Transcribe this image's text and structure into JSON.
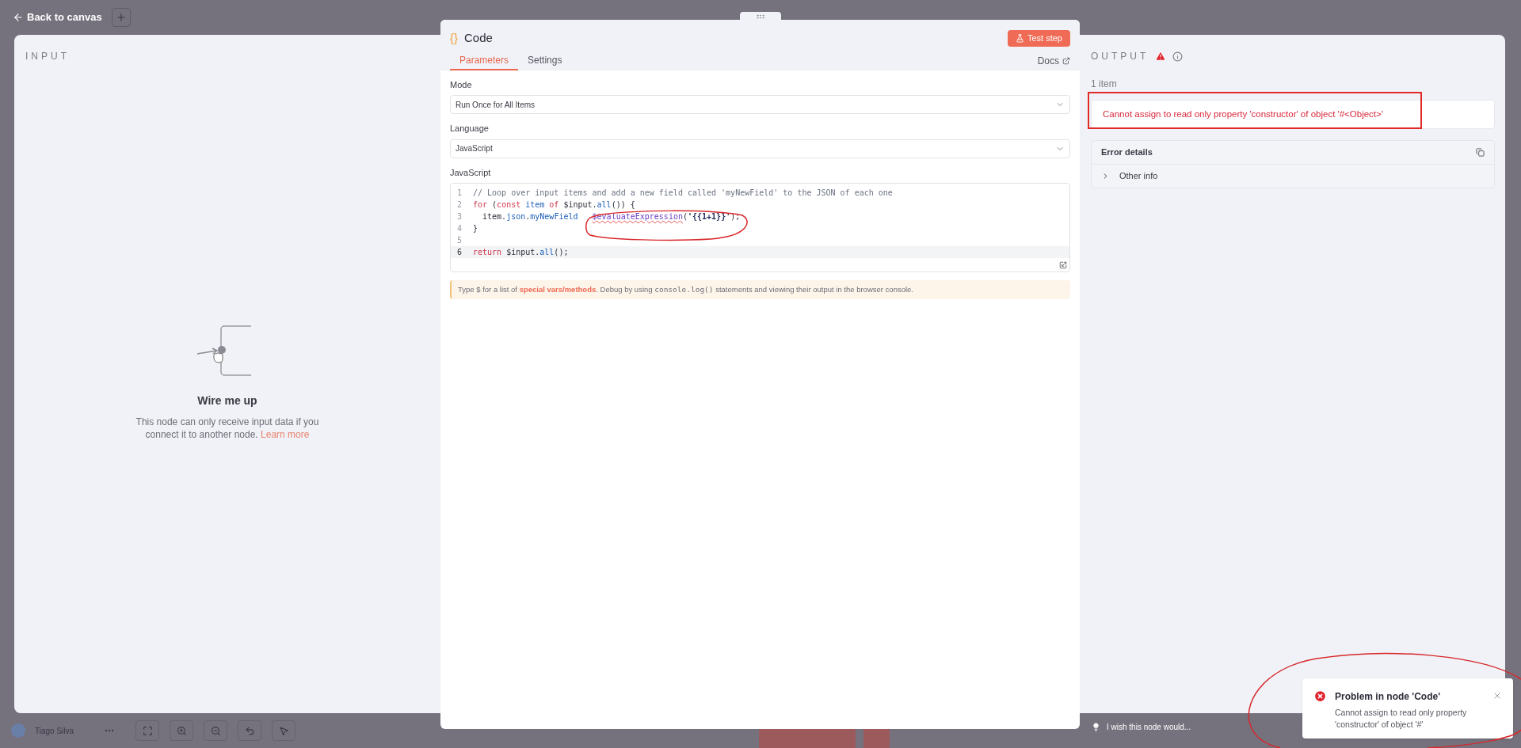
{
  "top_bar": {
    "back_link": "Back to canvas"
  },
  "input": {
    "heading": "INPUT",
    "empty_title": "Wire me up",
    "empty_text": "This node can only receive input data if you connect it to another node.",
    "learn_more": "Learn more"
  },
  "node_panel": {
    "icon_glyph": "{}",
    "title": "Code",
    "test_button": "Test step",
    "tabs": [
      {
        "label": "Parameters",
        "selected": true
      },
      {
        "label": "Settings",
        "selected": false
      }
    ],
    "docs_link": "Docs",
    "fields": [
      {
        "label": "Mode",
        "value": "Run Once for All Items"
      },
      {
        "label": "Language",
        "value": "JavaScript"
      }
    ],
    "editor": {
      "label": "JavaScript",
      "lines": [
        {
          "number": "1",
          "active": false,
          "tokens": [
            {
              "kind": "comment",
              "text": "// Loop over input items and add a new field called 'myNewField' to the JSON of each one"
            }
          ]
        },
        {
          "number": "2",
          "active": false,
          "tokens": [
            {
              "kind": "keyword",
              "text": "for"
            },
            {
              "kind": "plain",
              "text": " ("
            },
            {
              "kind": "keyword",
              "text": "const"
            },
            {
              "kind": "property",
              "text": " item"
            },
            {
              "kind": "keyword",
              "text": " of"
            },
            {
              "kind": "plain",
              "text": " $input."
            },
            {
              "kind": "property",
              "text": "all"
            },
            {
              "kind": "plain",
              "text": "()) {"
            }
          ]
        },
        {
          "number": "3",
          "active": false,
          "tokens": [
            {
              "kind": "plain",
              "text": "  item."
            },
            {
              "kind": "property",
              "text": "json"
            },
            {
              "kind": "plain",
              "text": "."
            },
            {
              "kind": "property",
              "text": "myNewField   "
            },
            {
              "kind": "function",
              "text": "$evaluateExpression"
            },
            {
              "kind": "plain",
              "text": "("
            },
            {
              "kind": "string",
              "text": "'{{1+1}}'"
            },
            {
              "kind": "plain",
              "text": ");"
            }
          ]
        },
        {
          "number": "4",
          "active": false,
          "tokens": [
            {
              "kind": "plain",
              "text": "}"
            }
          ]
        },
        {
          "number": "5",
          "active": false
        },
        {
          "number": "6",
          "active": true,
          "tokens": [
            {
              "kind": "keyword",
              "text": "return"
            },
            {
              "kind": "plain",
              "text": " $input."
            },
            {
              "kind": "property",
              "text": "all"
            },
            {
              "kind": "plain",
              "text": "();"
            }
          ]
        }
      ]
    },
    "hint": [
      {
        "kind": "text",
        "text": "Type $ for a list of "
      },
      {
        "kind": "link",
        "text": "special vars/methods"
      },
      {
        "kind": "text",
        "text": ". Debug by using "
      },
      {
        "kind": "code",
        "text": "console.log()"
      },
      {
        "kind": "text",
        "text": " statements and viewing their output in the browser console."
      }
    ]
  },
  "output": {
    "heading": "OUTPUT",
    "item_count": "1 item",
    "error_message": "Cannot assign to read only property 'constructor' of object '#<Object>'",
    "error_details": {
      "title": "Error details",
      "rows": [
        {
          "label": "Other info",
          "expanded": false
        }
      ]
    }
  },
  "bottom_bar": {
    "user_name": "Tiago Silva",
    "feedback": "I wish this node would..."
  },
  "toast": {
    "title": "Problem in node 'Code'",
    "message": "Cannot assign to read only property 'constructor' of object '#'"
  }
}
